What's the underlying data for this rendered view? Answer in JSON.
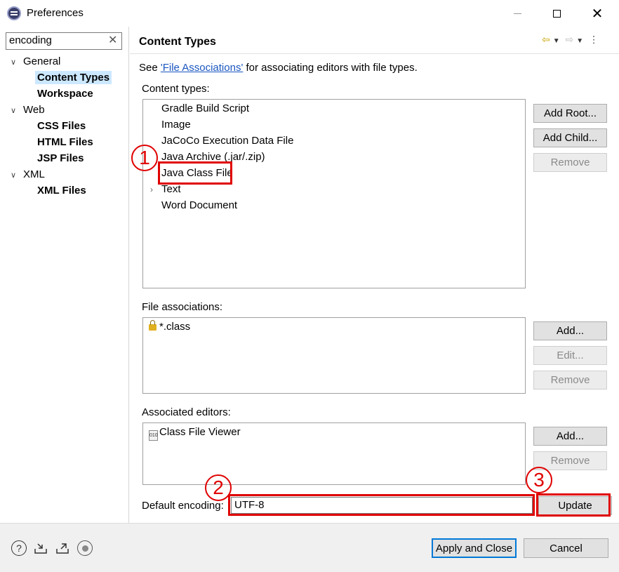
{
  "window": {
    "title": "Preferences",
    "minimize": "—",
    "maximize": "",
    "close": "✕"
  },
  "left": {
    "filter_value": "encoding",
    "clear": "✕",
    "tree": [
      {
        "label": "General"
      },
      {
        "label": "Content Types"
      },
      {
        "label": "Workspace"
      },
      {
        "label": "Web"
      },
      {
        "label": "CSS Files"
      },
      {
        "label": "HTML Files"
      },
      {
        "label": "JSP Files"
      },
      {
        "label": "XML"
      },
      {
        "label": "XML Files"
      }
    ]
  },
  "page": {
    "title": "Content Types",
    "desc_prefix": "See ",
    "desc_link": "'File Associations'",
    "desc_suffix": " for associating editors with file types.",
    "content_types_label": "Content types:",
    "content_types": [
      "Gradle Build Script",
      "Image",
      "JaCoCo Execution Data File",
      "Java Archive (.jar/.zip)",
      "Java Class File",
      "Text",
      "Word Document"
    ],
    "file_assoc_label": "File associations:",
    "file_assoc": [
      "*.class"
    ],
    "assoc_editors_label": "Associated editors:",
    "assoc_editors": [
      "Class File Viewer"
    ],
    "default_encoding_label": "Default encoding:",
    "default_encoding_value": "UTF-8",
    "buttons": {
      "add_root": "Add Root...",
      "add_child": "Add Child...",
      "remove": "Remove",
      "add": "Add...",
      "edit": "Edit...",
      "update": "Update"
    }
  },
  "annotations": [
    "1",
    "2",
    "3"
  ],
  "annotation_color": "#e00000",
  "footer": {
    "apply_close": "Apply and Close",
    "cancel": "Cancel"
  }
}
